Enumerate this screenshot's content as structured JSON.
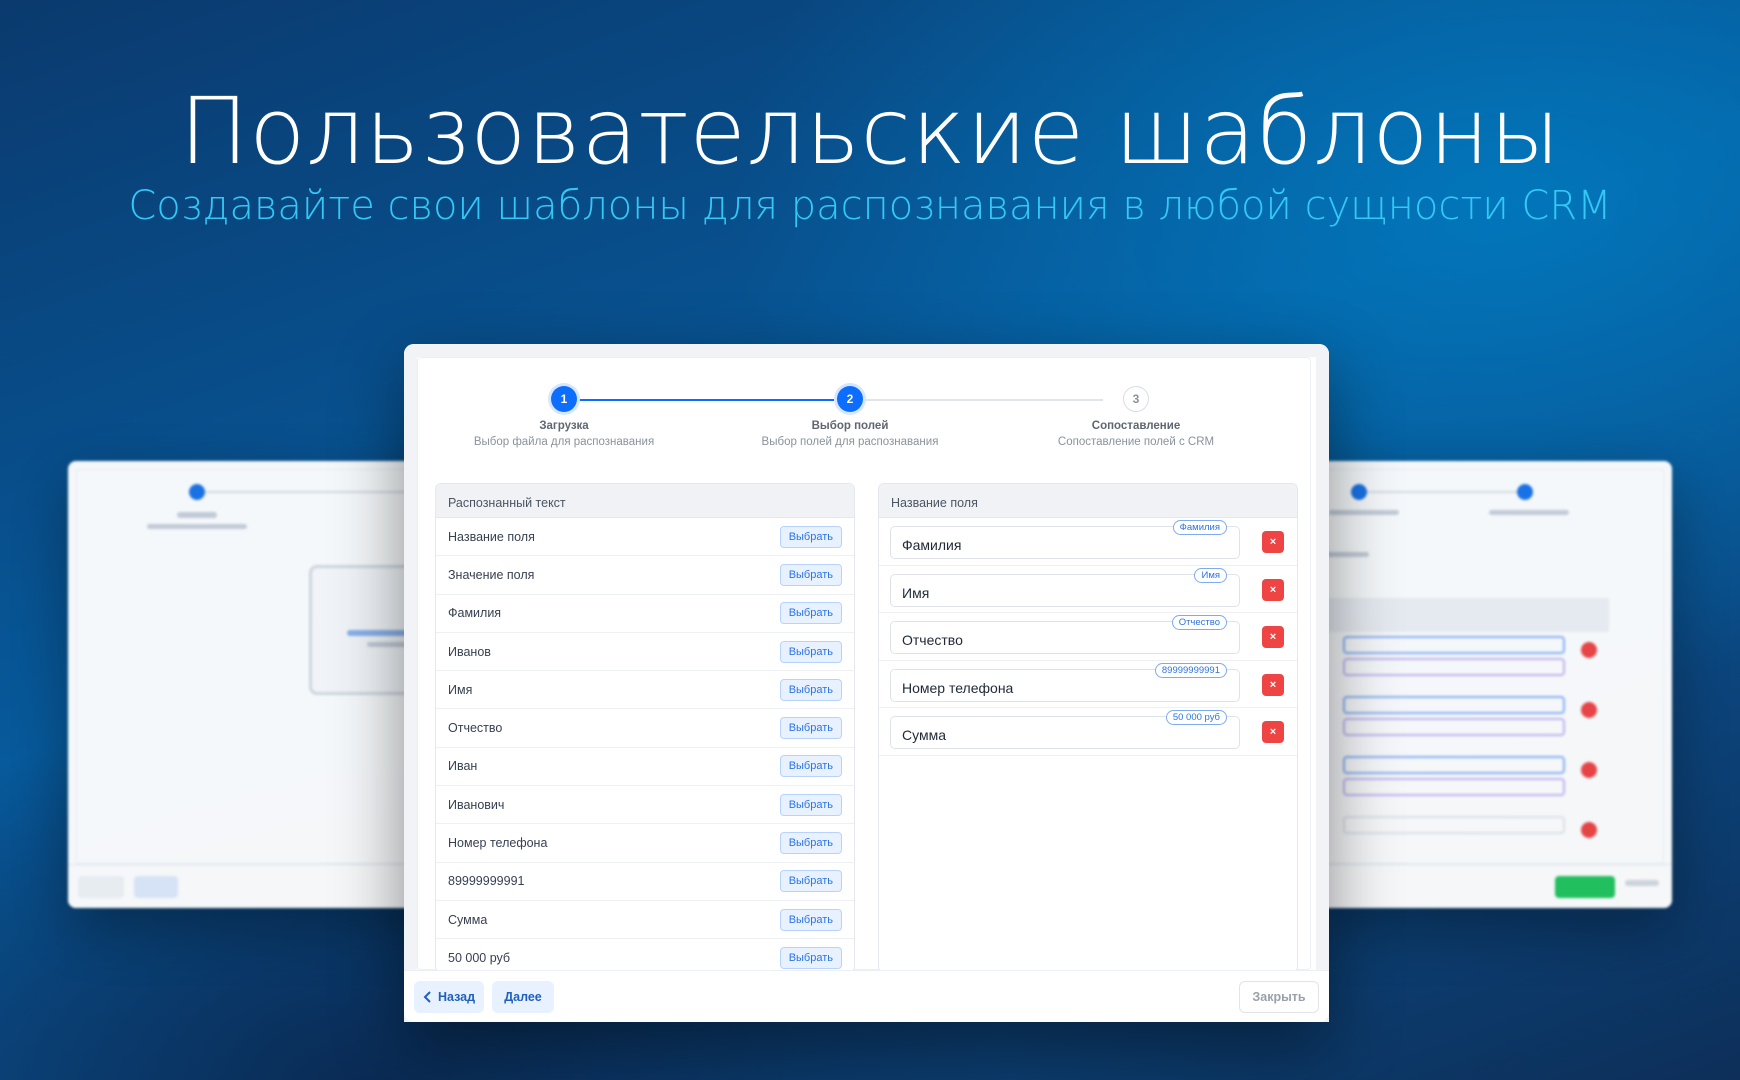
{
  "hero": {
    "title": "Пользовательские шаблоны",
    "subtitle": "Создавайте свои шаблоны для распознавания в любой сущности CRM"
  },
  "stepper": {
    "steps": [
      {
        "number": "1",
        "title": "Загрузка",
        "desc": "Выбор файла для распознавания",
        "state": "active"
      },
      {
        "number": "2",
        "title": "Выбор полей",
        "desc": "Выбор полей для распознавания",
        "state": "active"
      },
      {
        "number": "3",
        "title": "Сопоставление",
        "desc": "Сопоставление полей с CRM",
        "state": "inactive"
      }
    ]
  },
  "recognized": {
    "header": "Распознанный текст",
    "button_label": "Выбрать",
    "items": [
      "Название поля",
      "Значение поля",
      "Фамилия",
      "Иванов",
      "Имя",
      "Отчество",
      "Иван",
      "Иванович",
      "Номер телефона",
      "89999999991",
      "Сумма",
      "50 000 руб"
    ]
  },
  "fields": {
    "header": "Название поля",
    "delete_symbol": "×",
    "items": [
      {
        "name": "Фамилия",
        "tag": "Фамилия"
      },
      {
        "name": "Имя",
        "tag": "Имя"
      },
      {
        "name": "Отчество",
        "tag": "Отчество"
      },
      {
        "name": "Номер телефона",
        "tag": "89999999991"
      },
      {
        "name": "Сумма",
        "tag": "50 000 руб"
      }
    ]
  },
  "footer": {
    "back_icon": "chevron-left-icon",
    "back_label": "Назад",
    "next_label": "Далее",
    "close_label": "Закрыть"
  },
  "colors": {
    "accent": "#0d6efd",
    "danger": "#ef4444",
    "subtitle": "#33c8f5"
  }
}
